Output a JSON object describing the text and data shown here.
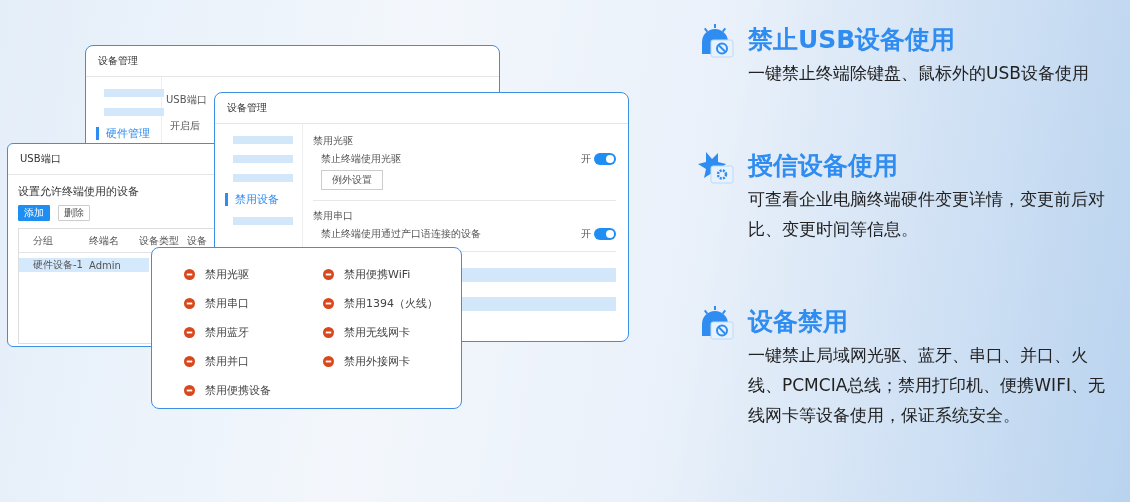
{
  "back_window": {
    "title": "设备管理",
    "sidebar": [
      {
        "kind": "bar",
        "selected": false
      },
      {
        "kind": "bar",
        "selected": false
      },
      {
        "kind": "label",
        "label": "硬件管理",
        "selected": true
      }
    ],
    "section_label": "USB端口",
    "setting_text": "开启后"
  },
  "usb_window": {
    "title": "USB端口",
    "heading": "设置允许终端使用的设备",
    "buttons": [
      {
        "label": "添加",
        "kind": "primary"
      },
      {
        "label": "删除",
        "kind": "default"
      }
    ],
    "table": {
      "columns": [
        "分组",
        "终端名",
        "设备类型",
        "设备"
      ],
      "rows": [
        {
          "cells": [
            "硬件设备-1",
            "Admin"
          ],
          "selected": true
        }
      ]
    }
  },
  "settings_window": {
    "title": "设备管理",
    "sidebar": [
      {
        "kind": "bar",
        "selected": false
      },
      {
        "kind": "bar",
        "selected": false
      },
      {
        "kind": "bar",
        "selected": false
      },
      {
        "kind": "label",
        "label": "禁用设备",
        "selected": true
      },
      {
        "kind": "bar",
        "selected": false
      }
    ],
    "sections": [
      {
        "title": "禁用光驱",
        "description": "禁止终端使用光驱",
        "switch_label": "开",
        "on": true,
        "button": "例外设置"
      },
      {
        "title": "禁用串口",
        "description": "禁止终端使用通过产口语连接的设备",
        "switch_label": "开",
        "on": true
      }
    ]
  },
  "blocked_list": {
    "columns": [
      [
        "禁用光驱",
        "禁用串口",
        "禁用蓝牙",
        "禁用并口",
        "禁用便携设备"
      ],
      [
        "禁用便携WiFi",
        "禁用1394（火线）",
        "禁用无线网卡",
        "禁用外接网卡"
      ]
    ]
  },
  "features": [
    {
      "kind": "block",
      "title": "禁止USB设备使用",
      "description": "一键禁止终端除键盘、鼠标外的USB设备使用"
    },
    {
      "kind": "gear",
      "title": "授信设备使用",
      "description": "可查看企业电脑终端硬件变更详情，变更前后对比、变更时间等信息。"
    },
    {
      "kind": "block",
      "title": "设备禁用",
      "description": "一键禁止局域网光驱、蓝牙、串口、并口、火线、PCMCIA总线；禁用打印机、便携WIFI、无线网卡等设备使用，保证系统安全。"
    }
  ]
}
